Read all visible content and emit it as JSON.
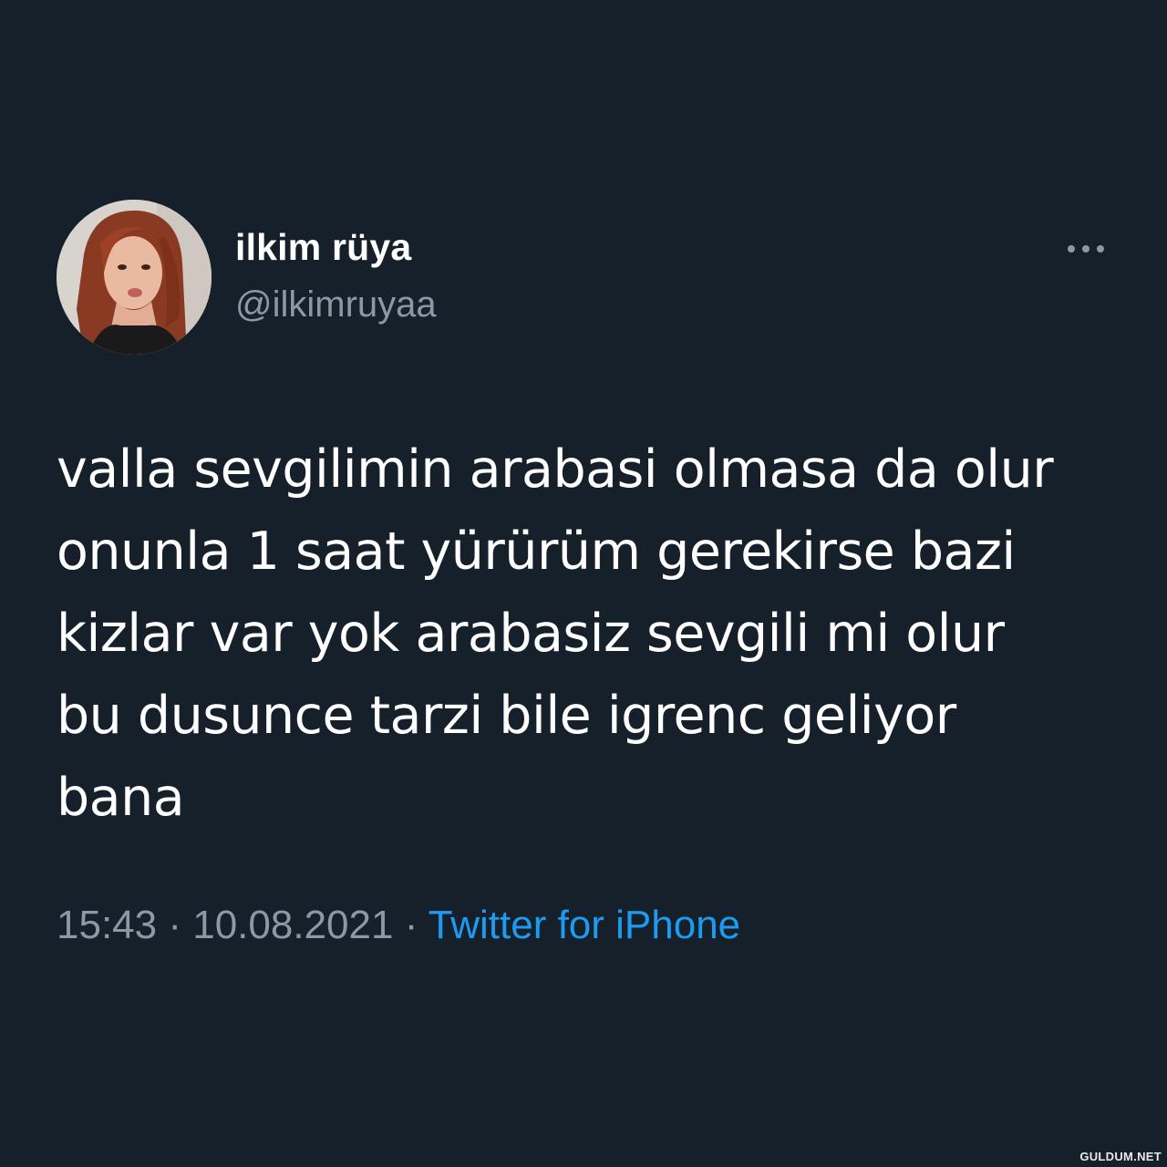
{
  "tweet": {
    "author": {
      "display_name": "ilkim rüya",
      "handle": "@ilkimruyaa"
    },
    "text": "valla sevgilimin arabasi olmasa da olur\nonunla 1 saat yürürüm gerekirse bazi\nkizlar var yok arabasiz sevgili mi olur\nbu dusunce tarzi bile igrenc geliyor\nbana",
    "time": "15:43",
    "separator": "·",
    "date": "10.08.2021",
    "source": "Twitter for iPhone",
    "more_icon": "more-horizontal-icon"
  },
  "colors": {
    "background": "#15202b",
    "primary_text": "#ffffff",
    "secondary_text": "#8b98a5",
    "accent": "#1d9bf0"
  },
  "watermark": "GULDUM.NET"
}
